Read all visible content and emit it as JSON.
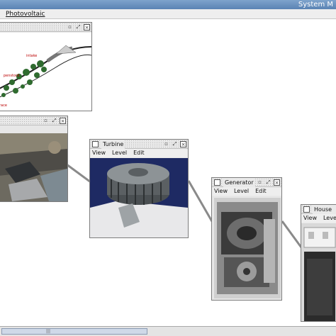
{
  "window": {
    "title": "System M"
  },
  "menubar": {
    "items": [
      {
        "label": "Photovoltaic"
      }
    ]
  },
  "frames": {
    "site": {
      "title": "",
      "diagram_labels": [
        "intake",
        "penstock",
        "race"
      ]
    },
    "dam": {
      "title": ""
    },
    "turbine": {
      "title": "Turbine",
      "menu": [
        "View",
        "Level",
        "Edit"
      ]
    },
    "generator": {
      "title": "Generator",
      "menu": [
        "View",
        "Level",
        "Edit"
      ]
    },
    "house": {
      "title": "House Lo",
      "menu": [
        "View",
        "Level"
      ]
    }
  },
  "icons": {
    "minimize": "minimize-icon",
    "maximize": "maximize-icon",
    "close": "close-icon"
  },
  "colors": {
    "titlebar": "#6b92c2",
    "connector": "#8a8a8a"
  }
}
